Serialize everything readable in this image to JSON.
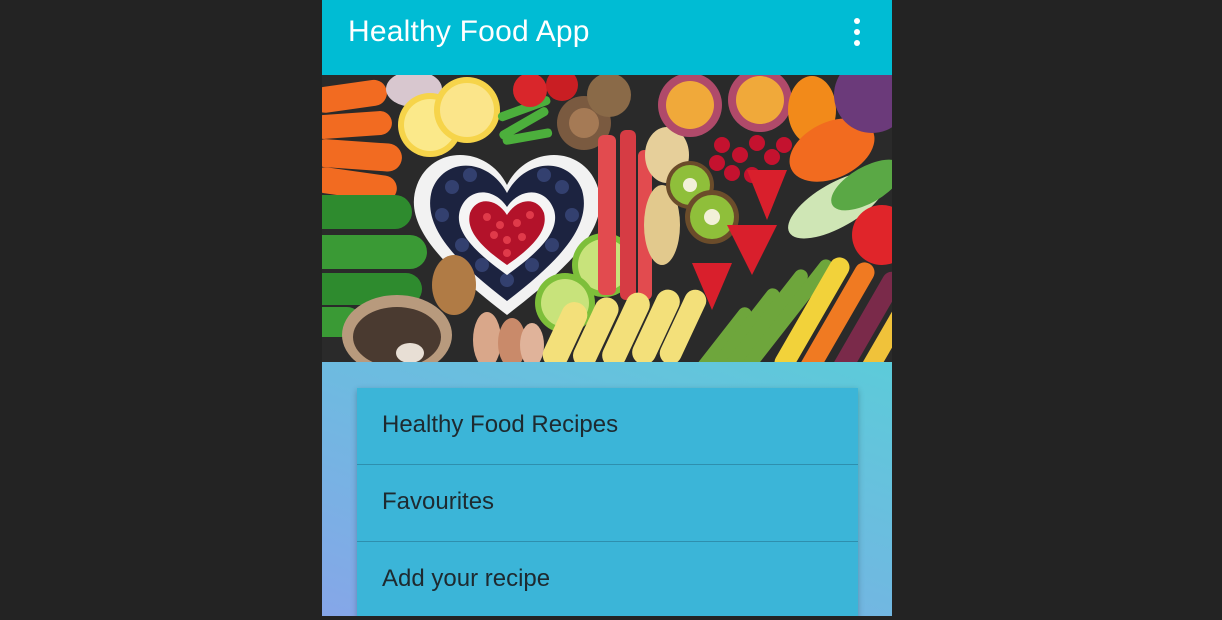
{
  "app": {
    "title": "Healthy Food App",
    "overflow_icon": "more-vert-icon",
    "accent_color": "#00bcd4"
  },
  "hero": {
    "image": "fruit-and-vegetable-banner"
  },
  "menu": {
    "items": [
      {
        "label": "Healthy Food Recipes"
      },
      {
        "label": "Favourites"
      },
      {
        "label": "Add your recipe"
      }
    ]
  }
}
